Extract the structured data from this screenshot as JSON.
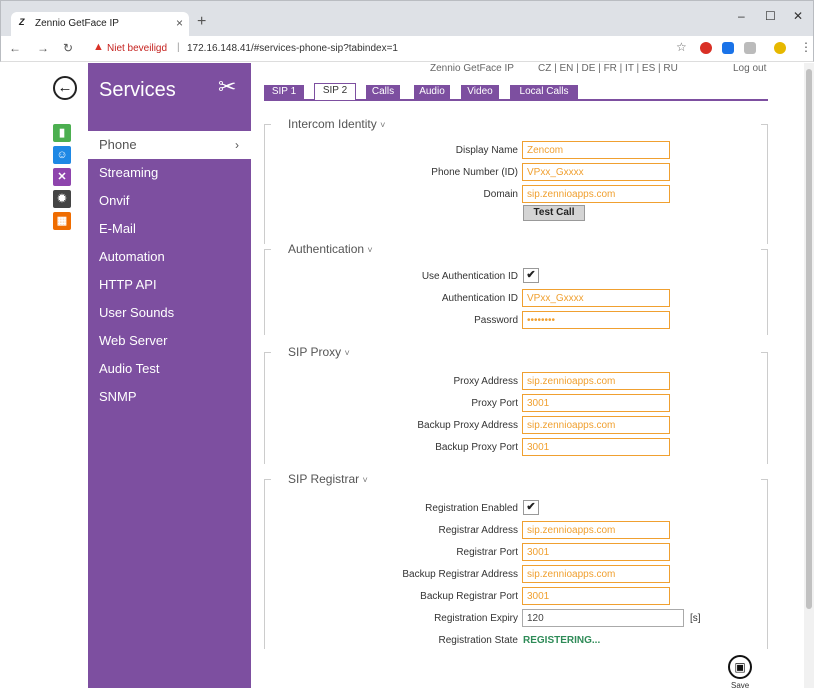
{
  "browser": {
    "tab_title": "Zennio GetFace IP",
    "tab_favicon": "Z",
    "insecure_label": "Niet beveiligd",
    "url": "172.16.148.41/#services-phone-sip?tabindex=1"
  },
  "header": {
    "product": "Zennio GetFace IP",
    "languages": "CZ | EN | DE | FR | IT | ES | RU",
    "logout": "Log out"
  },
  "sidebar": {
    "title": "Services",
    "items": [
      {
        "label": "Phone",
        "active": true
      },
      {
        "label": "Streaming"
      },
      {
        "label": "Onvif"
      },
      {
        "label": "E-Mail"
      },
      {
        "label": "Automation"
      },
      {
        "label": "HTTP API"
      },
      {
        "label": "User Sounds"
      },
      {
        "label": "Web Server"
      },
      {
        "label": "Audio Test"
      },
      {
        "label": "SNMP"
      }
    ]
  },
  "tabs": [
    "SIP 1",
    "SIP 2",
    "Calls",
    "Audio",
    "Video",
    "Local Calls"
  ],
  "active_tab": "SIP 2",
  "sections": {
    "intercom_identity": {
      "title": "Intercom Identity",
      "display_name_label": "Display Name",
      "display_name": "Zencom",
      "phone_number_label": "Phone Number (ID)",
      "phone_number": "VPxx_Gxxxx",
      "domain_label": "Domain",
      "domain": "sip.zennioapps.com",
      "test_call": "Test Call"
    },
    "authentication": {
      "title": "Authentication",
      "use_auth_label": "Use Authentication ID",
      "use_auth_checked": true,
      "auth_id_label": "Authentication ID",
      "auth_id": "VPxx_Gxxxx",
      "password_label": "Password",
      "password": "••••••••"
    },
    "sip_proxy": {
      "title": "SIP Proxy",
      "proxy_address_label": "Proxy Address",
      "proxy_address": "sip.zennioapps.com",
      "proxy_port_label": "Proxy Port",
      "proxy_port": "3001",
      "backup_proxy_address_label": "Backup Proxy Address",
      "backup_proxy_address": "sip.zennioapps.com",
      "backup_proxy_port_label": "Backup Proxy Port",
      "backup_proxy_port": "3001"
    },
    "sip_registrar": {
      "title": "SIP Registrar",
      "reg_enabled_label": "Registration Enabled",
      "reg_enabled_checked": true,
      "registrar_address_label": "Registrar Address",
      "registrar_address": "sip.zennioapps.com",
      "registrar_port_label": "Registrar Port",
      "registrar_port": "3001",
      "backup_registrar_address_label": "Backup Registrar Address",
      "backup_registrar_address": "sip.zennioapps.com",
      "backup_registrar_port_label": "Backup Registrar Port",
      "backup_registrar_port": "3001",
      "reg_expiry_label": "Registration Expiry",
      "reg_expiry": "120",
      "reg_expiry_unit": "[s]",
      "reg_state_label": "Registration State",
      "reg_state": "REGISTERING..."
    }
  },
  "save_label": "Save",
  "colors": {
    "accent": "#7d4fa0",
    "field_border": "#f0a030",
    "state_ok": "#2e8b57"
  }
}
